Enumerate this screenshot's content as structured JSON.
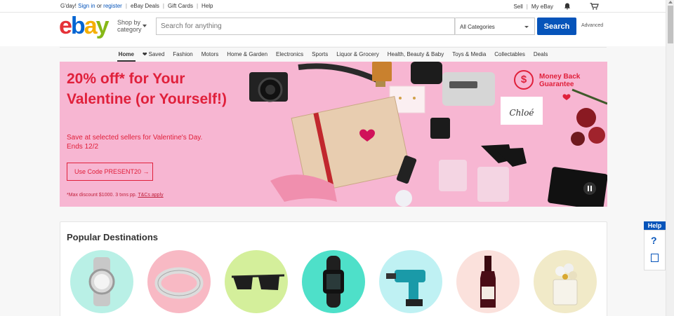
{
  "topbar": {
    "greeting": "G'day!",
    "sign_in": "Sign in",
    "or": "or",
    "register": "register",
    "links": [
      "eBay Deals",
      "Gift Cards",
      "Help"
    ],
    "sell": "Sell",
    "my_ebay": "My eBay",
    "icons": [
      "bell-icon",
      "cart-icon"
    ]
  },
  "header": {
    "logo": [
      "e",
      "b",
      "a",
      "y"
    ],
    "shop_by_line1": "Shop by",
    "shop_by_line2": "category",
    "search_placeholder": "Search for anything",
    "category_selected": "All Categories",
    "search_button": "Search",
    "advanced": "Advanced"
  },
  "nav": {
    "items": [
      "Home",
      "Saved",
      "Fashion",
      "Motors",
      "Home & Garden",
      "Electronics",
      "Sports",
      "Liquor & Grocery",
      "Health, Beauty & Baby",
      "Toys & Media",
      "Collectables",
      "Deals"
    ],
    "active": "Home"
  },
  "banner": {
    "title": "20% off* for Your Valentine (or Yourself!)",
    "subtitle": "Save at selected sellers for Valentine's Day. Ends 12/2",
    "code_button": "Use Code PRESENT20 →",
    "fine_print": "*Max discount $1000. 3 txns pp.",
    "fine_link": "T&Cs apply",
    "badge_line1": "Money Back",
    "badge_line2": "Guarantee",
    "badge_symbol": "$",
    "brand_box_text": "Chloé",
    "colors": {
      "accent": "#e0203b",
      "background": "#f7b6d2"
    }
  },
  "popular": {
    "title": "Popular Destinations",
    "items": [
      "watch",
      "bracelet",
      "sunglasses",
      "fitness-tracker",
      "drill",
      "wine",
      "perfume"
    ]
  },
  "help": {
    "label": "Help",
    "question": "?"
  },
  "colors": {
    "brand_blue": "#0654ba"
  }
}
